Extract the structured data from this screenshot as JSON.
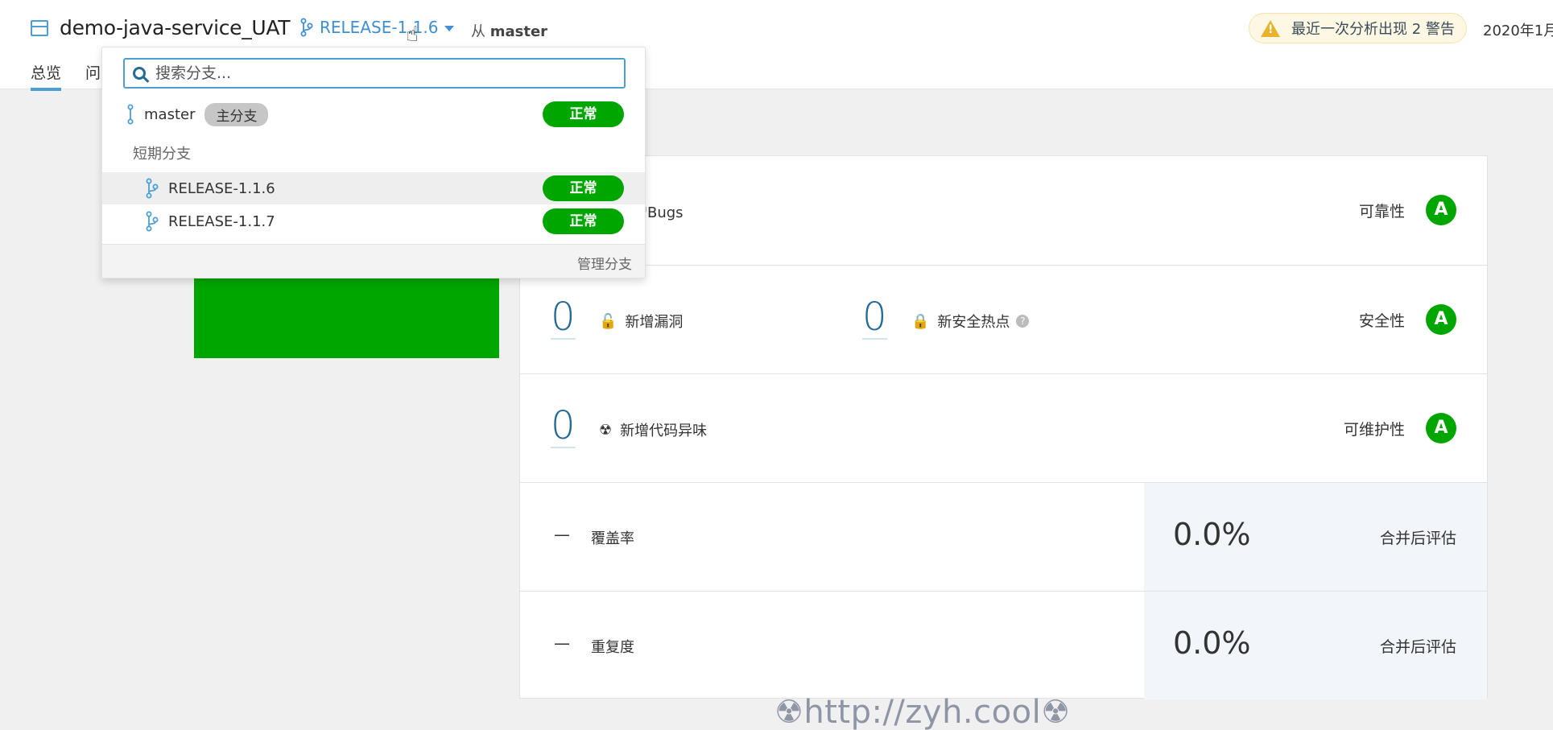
{
  "header": {
    "project_name": "demo-java-service_UAT",
    "branch": "RELEASE-1.1.6",
    "from_prefix": "从",
    "from_branch": "master",
    "warning": "最近一次分析出现 2 警告",
    "date": "2020年1月",
    "tabs": [
      "总览",
      "问"
    ]
  },
  "dropdown": {
    "search_placeholder": "搜索分支...",
    "main_branch": {
      "name": "master",
      "badge": "主分支",
      "status": "正常"
    },
    "group_label": "短期分支",
    "short_branches": [
      {
        "name": "RELEASE-1.1.6",
        "status": "正常"
      },
      {
        "name": "RELEASE-1.1.7",
        "status": "正常"
      }
    ],
    "manage_label": "管理分支"
  },
  "metrics": {
    "bugs": {
      "label": "增Bugs",
      "rating_label": "可靠性",
      "grade": "A"
    },
    "security": {
      "vuln_value": "0",
      "vuln_label": "新增漏洞",
      "hotspot_value": "0",
      "hotspot_label": "新安全热点",
      "rating_label": "安全性",
      "grade": "A"
    },
    "maintainability": {
      "value": "0",
      "label": "新增代码异味",
      "rating_label": "可维护性",
      "grade": "A"
    },
    "coverage": {
      "dash": "—",
      "label": "覆盖率",
      "pct": "0.0%",
      "merge_label": "合并后评估"
    },
    "duplication": {
      "dash": "—",
      "label": "重复度",
      "pct": "0.0%",
      "merge_label": "合并后评估"
    }
  },
  "watermark": "☢http://zyh.cool☢"
}
